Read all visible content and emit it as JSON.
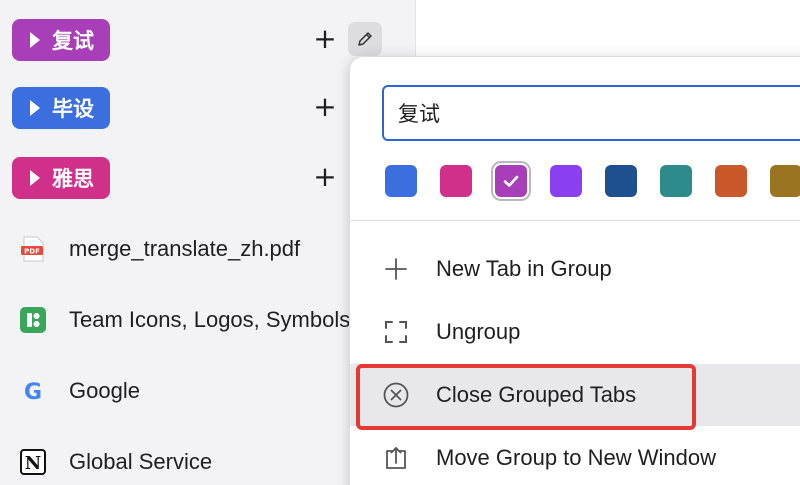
{
  "sidebar": {
    "groups": [
      {
        "label": "复试",
        "color": "#a93fb8"
      },
      {
        "label": "毕设",
        "color": "#3b6fe0"
      },
      {
        "label": "雅思",
        "color": "#d1308a"
      }
    ],
    "add_tab_glyph": "+",
    "tabs": [
      {
        "title": "merge_translate_zh.pdf",
        "icon": "pdf-icon",
        "badge": "PDF"
      },
      {
        "title": "Team Icons, Logos, Symbols",
        "icon": "team-icon"
      },
      {
        "title": "Google",
        "icon": "google-icon",
        "badge": "G"
      },
      {
        "title": "Global Service",
        "icon": "notion-icon",
        "badge": "N"
      }
    ]
  },
  "popup": {
    "group_name_value": "复试",
    "colors": [
      {
        "hex": "#3b6fe0",
        "selected": false
      },
      {
        "hex": "#d1308a",
        "selected": false
      },
      {
        "hex": "#a93fb8",
        "selected": true
      },
      {
        "hex": "#8a3ff0",
        "selected": false
      },
      {
        "hex": "#1e4f8f",
        "selected": false
      },
      {
        "hex": "#2e8b8b",
        "selected": false
      },
      {
        "hex": "#c8572a",
        "selected": false
      },
      {
        "hex": "#9a7420",
        "selected": false
      }
    ],
    "menu": [
      {
        "label": "New Tab in Group",
        "icon": "plus-icon"
      },
      {
        "label": "Ungroup",
        "icon": "ungroup-icon"
      },
      {
        "label": "Close Grouped Tabs",
        "icon": "close-circle-icon",
        "hover": true
      },
      {
        "label": "Move Group to New Window",
        "icon": "move-window-icon"
      }
    ]
  },
  "annotation": {
    "highlight_color": "#e53935"
  }
}
